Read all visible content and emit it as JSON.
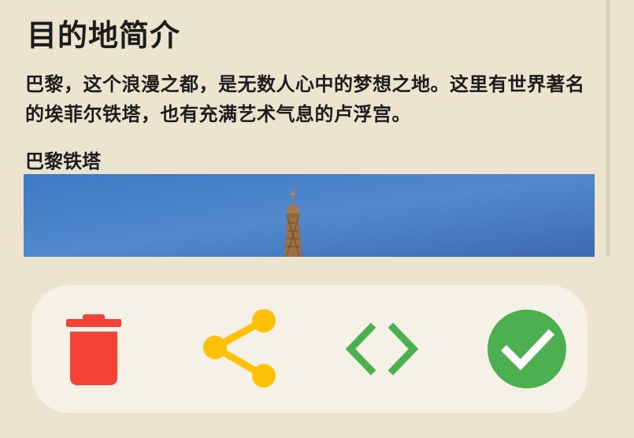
{
  "content": {
    "section_title": "目的地简介",
    "intro": "巴黎，这个浪漫之都，是无数人心中的梦想之地。这里有世界著名的埃菲尔铁塔，也有充满艺术气息的卢浮宫。",
    "sub_title": "巴黎铁塔"
  },
  "actions": [
    {
      "name": "delete",
      "icon": "trash-icon",
      "color": "#F44336"
    },
    {
      "name": "share",
      "icon": "share-icon",
      "color": "#FFC107"
    },
    {
      "name": "code",
      "icon": "code-icon",
      "color": "#4CAF50"
    },
    {
      "name": "confirm",
      "icon": "check-circle-icon",
      "color": "#4CAF50"
    }
  ],
  "colors": {
    "background": "#EDE4D0",
    "action_bar": "#F6F1E6",
    "text": "#1C1C1C",
    "sky": "#4F82C6"
  }
}
